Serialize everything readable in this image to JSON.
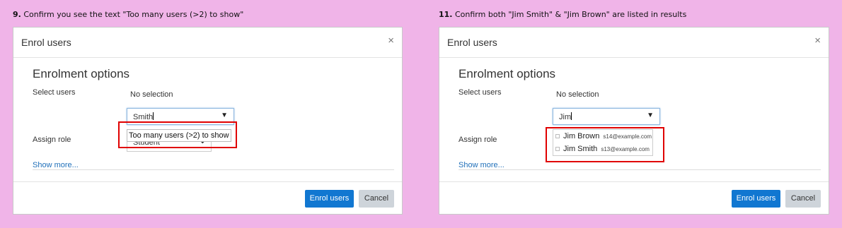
{
  "left": {
    "step_number": "9.",
    "step_text": "Confirm you see the text \"Too many users (>2) to show\"",
    "dialog_title": "Enrol users",
    "close_glyph": "×",
    "section_title": "Enrolment options",
    "select_users_label": "Select users",
    "no_selection": "No selection",
    "search_value": "Smith",
    "dropdown_arrow": "▼",
    "assign_role_label": "Assign role",
    "role_value": "Student",
    "role_arrow": "⬍",
    "popup_text": "Too many users (>2) to show",
    "show_more": "Show more...",
    "enrol_button": "Enrol users",
    "cancel_button": "Cancel"
  },
  "right": {
    "step_number": "11.",
    "step_text": "Confirm both \"Jim Smith\" & \"Jim Brown\" are listed in results",
    "dialog_title": "Enrol users",
    "close_glyph": "×",
    "section_title": "Enrolment options",
    "select_users_label": "Select users",
    "no_selection": "No selection",
    "search_value": "Jim",
    "dropdown_arrow": "▼",
    "assign_role_label": "Assign role",
    "results": [
      {
        "name": "Jim Brown",
        "email": "s14@example.com"
      },
      {
        "name": "Jim Smith",
        "email": "s13@example.com"
      }
    ],
    "show_more": "Show more...",
    "enrol_button": "Enrol users",
    "cancel_button": "Cancel"
  },
  "colors": {
    "background": "#f0b4e8",
    "primary_button": "#1177d1",
    "highlight": "#e00000",
    "link": "#1f6fb9"
  }
}
